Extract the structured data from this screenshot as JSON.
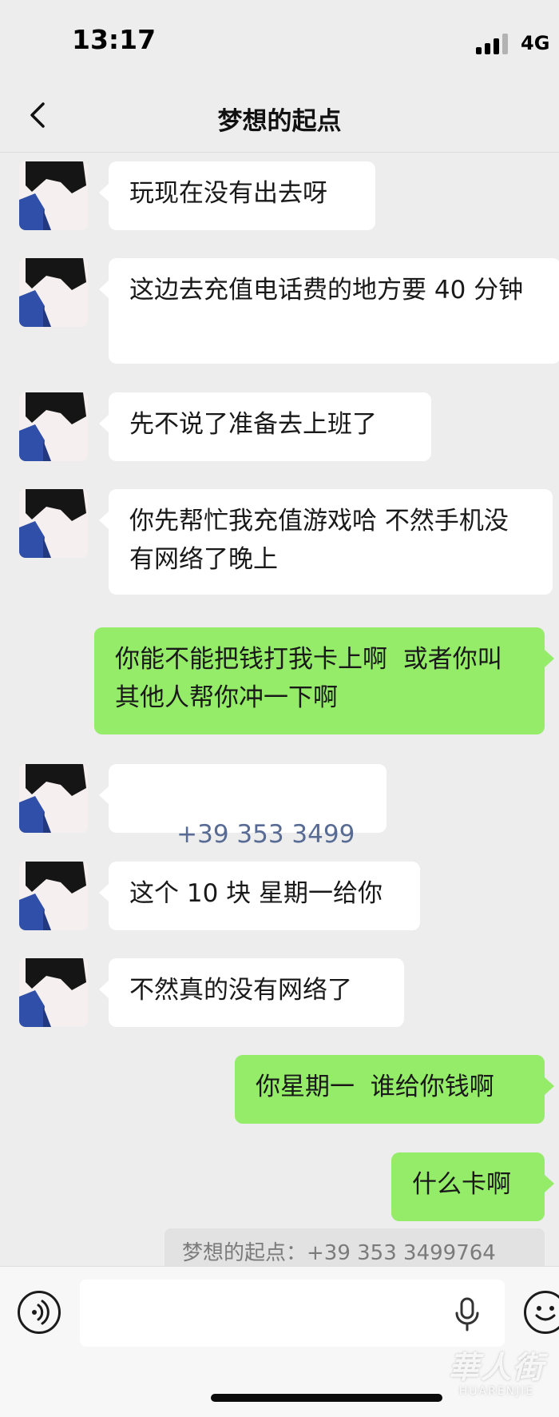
{
  "status_bar": {
    "time": "13:17",
    "network": "4G"
  },
  "header": {
    "title": "梦想的起点"
  },
  "messages": [
    {
      "side": "in",
      "text": "玩现在没有出去呀"
    },
    {
      "side": "in",
      "text": "这边去充值电话费的地方要 40 分钟"
    },
    {
      "side": "in",
      "text": "先不说了准备去上班了"
    },
    {
      "side": "in",
      "text": "你先帮忙我充值游戏哈 不然手机没有网络了晚上"
    },
    {
      "side": "out",
      "text": "你能不能把钱打我卡上啊  或者你叫其他人帮你冲一下啊"
    },
    {
      "side": "in",
      "text": "+39 353 3499764"
    },
    {
      "side": "in",
      "text": "这个 10 块 星期一给你"
    },
    {
      "side": "in",
      "text": "不然真的没有网络了"
    },
    {
      "side": "out",
      "text": "你星期一  谁给你钱啊"
    },
    {
      "side": "out",
      "text": "什么卡啊"
    }
  ],
  "quote": {
    "text": "梦想的起点：+39 353 3499764"
  },
  "input": {
    "value": ""
  },
  "watermark": {
    "main": "華人街",
    "sub": "HUARENJIE"
  },
  "colors": {
    "background": "#ededed",
    "incoming_bubble": "#ffffff",
    "outgoing_bubble": "#95ec69",
    "link": "#576b95"
  },
  "icons": {
    "back": "chevron-left-icon",
    "voice": "voice-icon",
    "mic": "mic-icon",
    "emoji": "emoji-icon"
  }
}
